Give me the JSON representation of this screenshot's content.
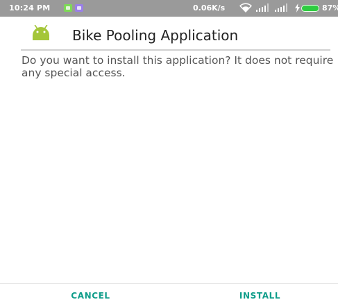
{
  "status_bar": {
    "time": "10:24 PM",
    "network_speed": "0.06K/s",
    "battery_percent": "87%",
    "battery_color": "#2ecc40",
    "notification_icons": [
      "app-notification-green-icon",
      "app-notification-purple-icon"
    ]
  },
  "header": {
    "app_name": "Bike Pooling Application",
    "icon": "android-icon",
    "icon_color": "#a4c639"
  },
  "body": {
    "message": "Do you want to install this application? It does not require any special access."
  },
  "actions": {
    "cancel_label": "CANCEL",
    "install_label": "INSTALL",
    "accent_color": "#0f9d8a"
  }
}
